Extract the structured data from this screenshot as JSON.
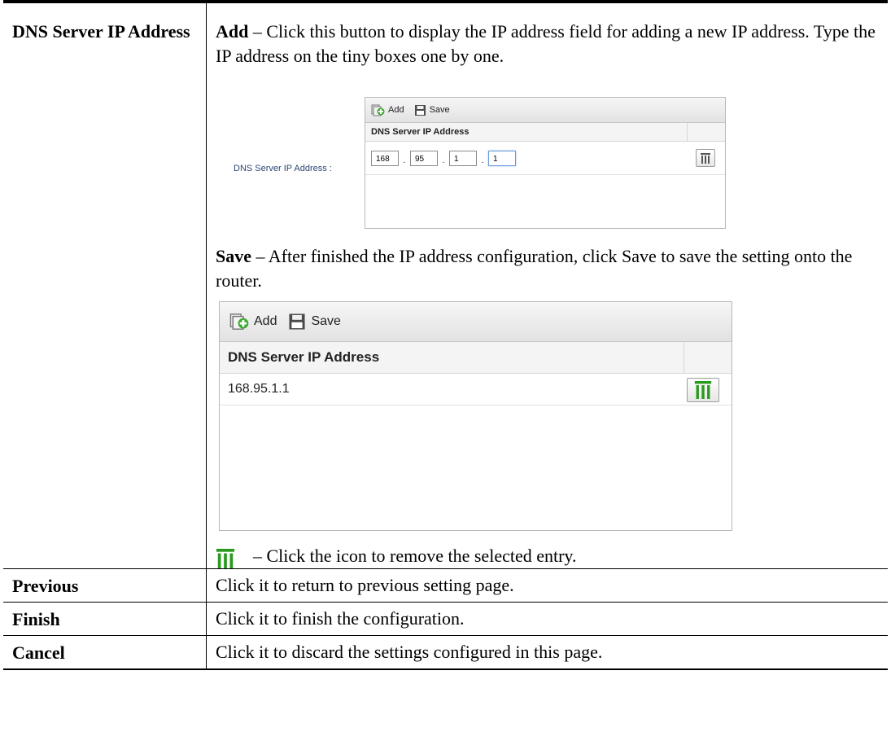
{
  "rows": [
    {
      "term": "DNS Server IP Address",
      "add_label": "Add",
      "add_text": " – Click this button to display the IP address field for adding a new IP address. Type the IP address on the tiny boxes one by one.",
      "save_label": "Save",
      "save_text": " – After finished the IP address configuration, click Save to save the setting onto the router.",
      "icon_text": "– Click the icon to remove the selected entry."
    },
    {
      "term": "Previous",
      "desc": "Click it to return to previous setting page."
    },
    {
      "term": "Finish",
      "desc": "Click it to finish the configuration."
    },
    {
      "term": "Cancel",
      "desc": "Click it to discard the settings configured in this page."
    }
  ],
  "screenshot_add": {
    "side_label": "DNS Server IP Address :",
    "toolbar": {
      "add": "Add",
      "save": "Save"
    },
    "column_header": "DNS Server IP Address",
    "ip_octets": [
      "168",
      "95",
      "1",
      "1"
    ],
    "ip_separator": ".",
    "icon": "trash-icon"
  },
  "screenshot_save": {
    "toolbar": {
      "add": "Add",
      "save": "Save"
    },
    "column_header": "DNS Server IP Address",
    "entries": [
      "168.95.1.1"
    ],
    "icon": "trash-icon",
    "icon_color": "#2a9a1e"
  }
}
